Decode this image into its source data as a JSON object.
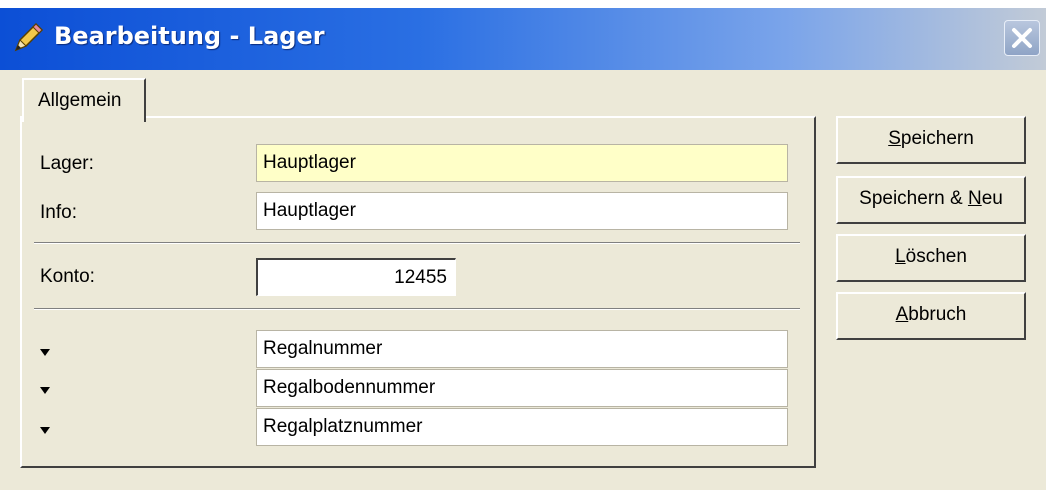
{
  "window": {
    "title": "Bearbeitung - Lager"
  },
  "tabs": [
    {
      "label": "Allgemein",
      "active": true
    }
  ],
  "form": {
    "lager_label": "Lager:",
    "lager_value": "Hauptlager",
    "info_label": "Info:",
    "info_value": "Hauptlager",
    "konto_label": "Konto:",
    "konto_value": "12455",
    "fields": [
      {
        "value": "Regalnummer"
      },
      {
        "value": "Regalbodennummer"
      },
      {
        "value": "Regalplatznummer"
      }
    ]
  },
  "buttons": {
    "save": {
      "pre": "",
      "accel": "S",
      "post": "peichern"
    },
    "save_new": {
      "pre": "Speichern & ",
      "accel": "N",
      "post": "eu"
    },
    "delete": {
      "pre": "",
      "accel": "L",
      "post": "öschen"
    },
    "cancel": {
      "pre": "",
      "accel": "A",
      "post": "bbruch"
    }
  },
  "colors": {
    "titlebar_start": "#0c4fd6",
    "window_bg": "#ece9d8",
    "required_field_bg": "#ffffc8"
  },
  "icons": {
    "title": "pencil-icon",
    "close": "close-icon",
    "row": "arrow-down-icon"
  }
}
